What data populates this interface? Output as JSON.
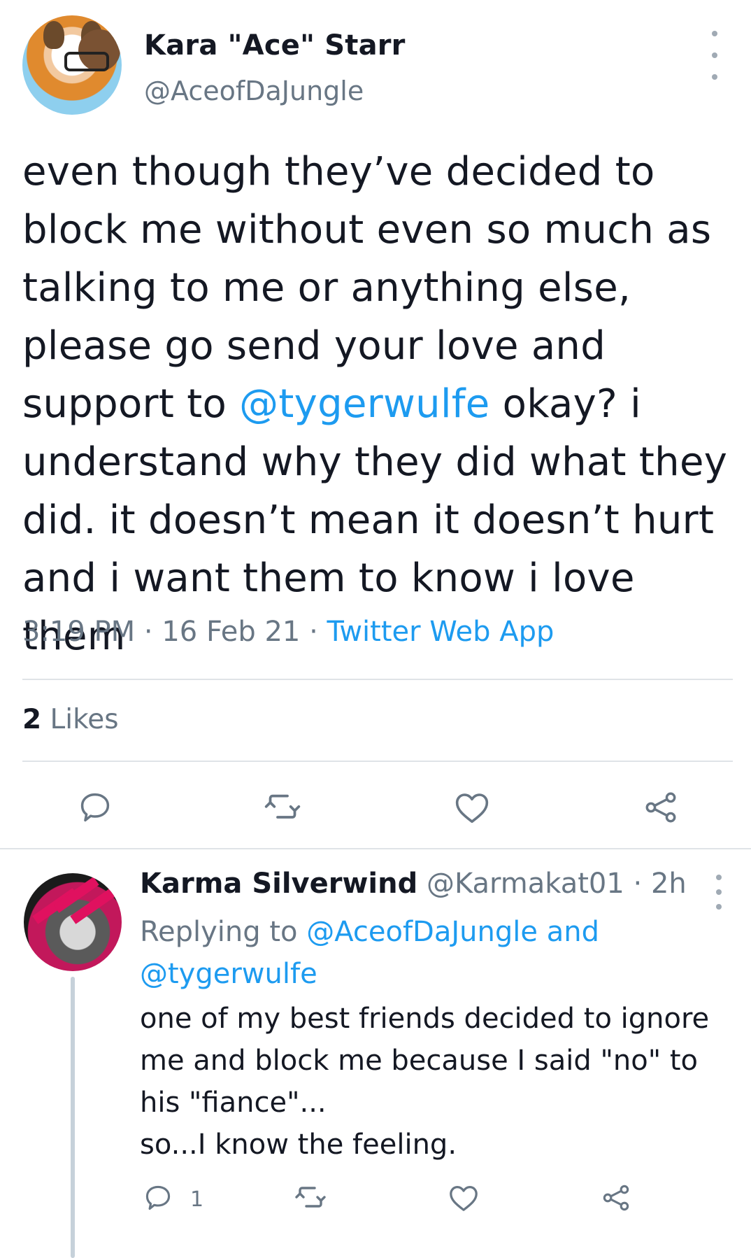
{
  "main_tweet": {
    "author_name": "Kara \"Ace\" Starr",
    "author_handle": "@AceofDaJungle",
    "text_before": "even though they’ve decided to block me without even so much as talking to me or anything else, please go send your love and support to ",
    "mention": "@tygerwulfe",
    "text_after": " okay? i understand why they did what they did. it doesn’t mean it doesn’t hurt and i want them to know i love them",
    "time": "3:19 PM",
    "date": "16 Feb 21",
    "source": "Twitter Web App",
    "likes_count": "2",
    "likes_label": "Likes",
    "separator": " · "
  },
  "reply": {
    "author_name": "Karma Silverwind",
    "author_handle": "@Karmakat01",
    "age": "2h",
    "replying_prefix": "Replying to",
    "replying_to_1": "@AceofDaJungle",
    "replying_and": "and",
    "replying_to_2": "@tygerwulfe",
    "text": "one of my best friends decided to ignore me and block me because I said \"no\" to his \"fiance\"...\nso...I know the feeling.",
    "reply_count": "1"
  },
  "colors": {
    "link": "#1d9bf0",
    "secondary": "#687684",
    "icon": "#687684",
    "divider": "#dfe3e7"
  },
  "icons": [
    "more-icon",
    "reply-icon",
    "retweet-icon",
    "like-icon",
    "share-icon"
  ]
}
